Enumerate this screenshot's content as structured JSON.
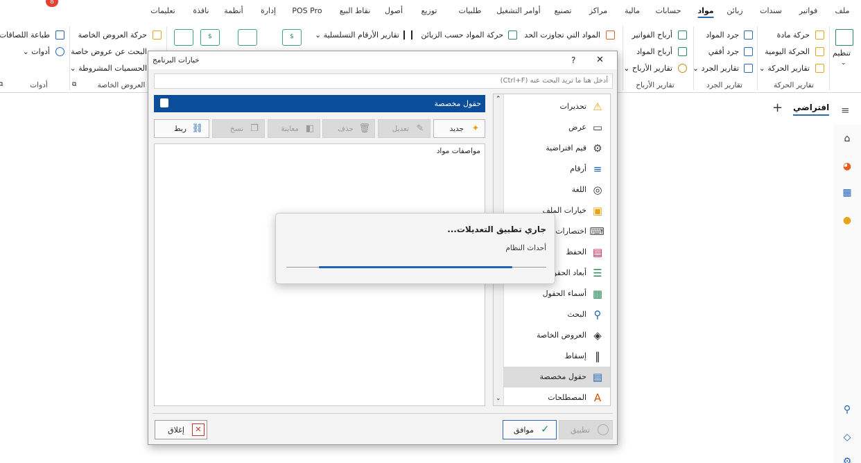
{
  "notification_count": "8",
  "menu": [
    {
      "label": "ملف",
      "active": false
    },
    {
      "label": "فواتير",
      "active": false
    },
    {
      "label": "سندات",
      "active": false
    },
    {
      "label": "زبائن",
      "active": false
    },
    {
      "label": "مواد",
      "active": true
    },
    {
      "label": "حسابات",
      "active": false
    },
    {
      "label": "مالية",
      "active": false
    },
    {
      "label": "مراكز",
      "active": false
    },
    {
      "label": "تصنيع",
      "active": false
    },
    {
      "label": "أوامر التشغيل",
      "active": false
    },
    {
      "label": "طلبيات",
      "active": false
    },
    {
      "label": "توزيع",
      "active": false
    },
    {
      "label": "أصول",
      "active": false
    },
    {
      "label": "نقاط البيع",
      "active": false
    },
    {
      "label": "POS Pro",
      "active": false
    },
    {
      "label": "إدارة",
      "active": false
    },
    {
      "label": "أنظمة",
      "active": false
    },
    {
      "label": "نافذة",
      "active": false
    },
    {
      "label": "تعليمات",
      "active": false
    }
  ],
  "ribbon": {
    "organize": "تنظيم",
    "g1": {
      "items": [
        "حركة مادة",
        "الحركة اليومية",
        "تقارير الحركة ⌄"
      ],
      "title": "تقارير الحركة"
    },
    "g2": {
      "items": [
        "جرد المواد",
        "جرد أفقي",
        "تقارير الجرد ⌄"
      ],
      "title": "تقارير الجرد"
    },
    "g3": {
      "items": [
        "أرباح الفواتير",
        "أرباح المواد",
        "تقارير الأرباح ⌄"
      ],
      "title": "تقارير الأرباح"
    },
    "g4": {
      "items": [
        "المواد التي تجاوزت الحد",
        "حركة المواد حسب الزبائن",
        "تقارير الأرقام التسلسلية ⌄"
      ]
    },
    "g5": {
      "items": [
        "حركة العروض الخاصة",
        "البحث عن عروض خاصة",
        "الحسميات المشروطة ⌄"
      ],
      "title": "العروض الخاصة"
    },
    "g6": {
      "items": [
        "طباعة اللصاقات",
        "أدوات ⌄"
      ],
      "title": "أدوات"
    }
  },
  "tab": {
    "label": "افتراضي",
    "add": "+"
  },
  "dialog": {
    "title": "خيارات البرنامج",
    "help": "?",
    "close": "✕",
    "search_placeholder": "أدخل هنا ما تريد البحث عنه (Ctrl+F)",
    "panel_title": "حقول مخصصة",
    "toolbar": {
      "new": "جديد",
      "edit": "تعديل",
      "delete": "حذف",
      "preview": "معاينة",
      "copy": "نسخ",
      "link": "ربط"
    },
    "fields": [
      "مواصفات مواد"
    ],
    "categories": [
      {
        "label": "تحذيرات",
        "icon": "⚠",
        "color": "#e8a317",
        "selected": false
      },
      {
        "label": "عرض",
        "icon": "▭",
        "color": "#333333",
        "selected": false
      },
      {
        "label": "قيم افتراضية",
        "icon": "⚙",
        "color": "#444444",
        "selected": false
      },
      {
        "label": "أرقام",
        "icon": "≡",
        "color": "#1e63b8",
        "selected": false
      },
      {
        "label": "اللغة",
        "icon": "◎",
        "color": "#333333",
        "selected": false
      },
      {
        "label": "خيارات الملف",
        "icon": "▣",
        "color": "#e8a317",
        "selected": false
      },
      {
        "label": "اختصارات",
        "icon": "⌨",
        "color": "#555555",
        "selected": false
      },
      {
        "label": "الحفظ",
        "icon": "▤",
        "color": "#c2185b",
        "selected": false
      },
      {
        "label": "أبعاد الحقول",
        "icon": "☰",
        "color": "#2a8c5a",
        "selected": false
      },
      {
        "label": "أسماء الحقول",
        "icon": "▦",
        "color": "#2a8c5a",
        "selected": false
      },
      {
        "label": "البحث",
        "icon": "⚲",
        "color": "#1e63b8",
        "selected": false
      },
      {
        "label": "العروض الخاصة",
        "icon": "◈",
        "color": "#333333",
        "selected": false
      },
      {
        "label": "إسقاط",
        "icon": "‖",
        "color": "#222222",
        "selected": false
      },
      {
        "label": "حقول مخصصة",
        "icon": "▤",
        "color": "#1e63b8",
        "selected": true
      },
      {
        "label": "المصطلحات",
        "icon": "A",
        "color": "#d35400",
        "selected": false
      }
    ],
    "buttons": {
      "close": "إغلاق",
      "ok": "موافق",
      "apply": "تطبيق"
    }
  },
  "progress": {
    "title": "جاري تطبيق التعديلات...",
    "subtitle": "أحداث النظام",
    "value": 0.87
  },
  "colors": {
    "accent": "#0a4d9b",
    "progress": "#1e63b8",
    "active_underline": "#2a6ab5"
  }
}
